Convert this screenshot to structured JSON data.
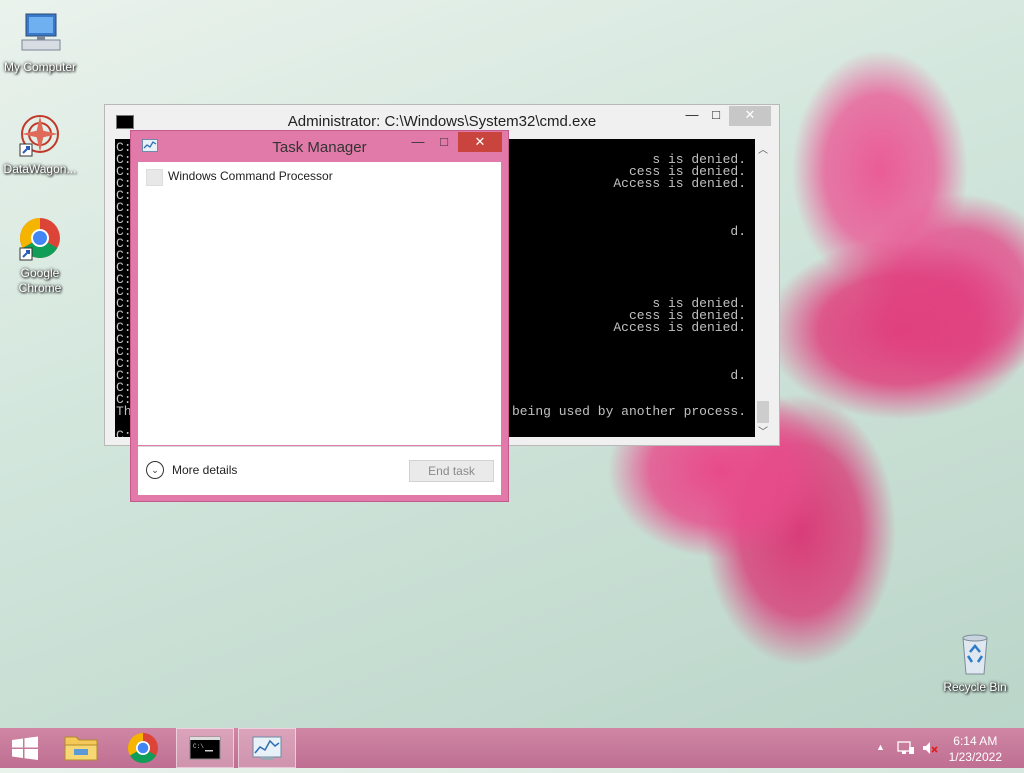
{
  "desktop": {
    "icons": [
      {
        "label": "My Computer"
      },
      {
        "label": "DataWagon..."
      },
      {
        "label": "Google Chrome"
      },
      {
        "label": "Recycle Bin"
      }
    ]
  },
  "cmd_window": {
    "title": "Administrator: C:\\Windows\\System32\\cmd.exe",
    "buttons": {
      "minimize": "—",
      "maximize": "□",
      "close": "✕"
    },
    "visible_left": [
      "C:",
      "C:",
      "C:",
      "C:",
      "C:",
      "C:",
      "C:",
      "C:",
      "C:",
      "C:",
      "C:",
      "C:",
      "C:",
      "C:",
      "C:",
      "C:",
      "C:",
      "C:",
      "C:",
      "C:",
      "C:",
      "C:",
      "Th",
      "",
      "C:"
    ],
    "visible_right": [
      "s is denied.",
      "cess is denied.",
      "Access is denied.",
      "",
      "",
      "",
      "d.",
      "",
      "",
      "",
      "",
      "",
      "s is denied.",
      "cess is denied.",
      "Access is denied.",
      "",
      "",
      "",
      "d.",
      "",
      "",
      "being used by another process."
    ]
  },
  "task_manager": {
    "title": "Task Manager",
    "buttons": {
      "minimize": "—",
      "maximize": "□",
      "close": "✕"
    },
    "processes": [
      {
        "name": "Windows Command Processor"
      }
    ],
    "more_details": "More details",
    "end_task": "End task"
  },
  "taskbar": {
    "time": "6:14 AM",
    "date": "1/23/2022"
  },
  "colors": {
    "accent": "#e17aa8",
    "taskbar": "#c87a9a",
    "close_button": "#c8443c"
  }
}
